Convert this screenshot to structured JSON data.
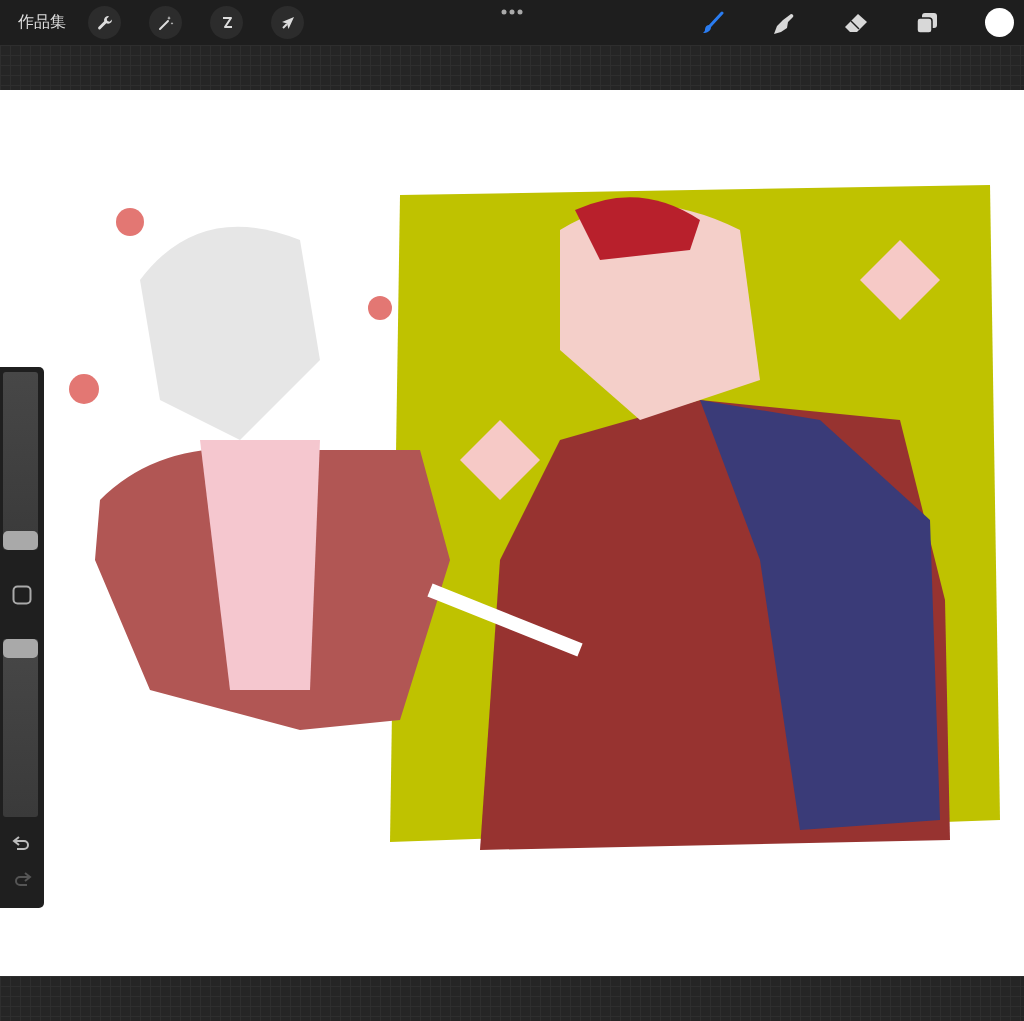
{
  "top_bar": {
    "gallery_label": "作品集"
  },
  "tools": [
    {
      "kind": "brush",
      "selected": true
    },
    {
      "kind": "smudge",
      "selected": false
    },
    {
      "kind": "eraser",
      "selected": false
    },
    {
      "kind": "layers",
      "selected": false
    }
  ],
  "sidebar": {
    "sliders": [
      {
        "level": 0
      },
      {
        "level": 1
      }
    ],
    "undo": {
      "disabled": false
    },
    "redo": {
      "disabled": true
    }
  }
}
